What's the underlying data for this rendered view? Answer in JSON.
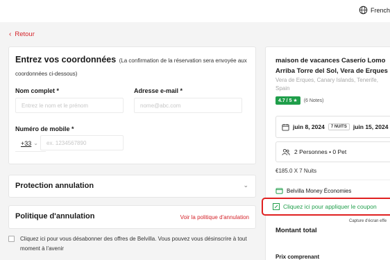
{
  "header": {
    "language": "French",
    "back_label": "Retour"
  },
  "contact": {
    "title": "Entrez vos coordonnées",
    "subtitle": "(La confirmation de la réservation sera envoyée aux coordonnées ci-dessous)",
    "full_name_label": "Nom complet *",
    "full_name_placeholder": "Entrez le nom et le prénom",
    "email_label": "Adresse e-mail *",
    "email_placeholder": "nome@abc.com",
    "mobile_label": "Numéro de mobile *",
    "country_code": "+33",
    "mobile_placeholder": "ex. 1234567890"
  },
  "protection": {
    "title": "Protection annulation"
  },
  "policy": {
    "title": "Politique d'annulation",
    "link_label": "Voir la politique d'annulation"
  },
  "unsubscribe": {
    "text": "Cliquez ici pour vous désabonner des offres de Belvilla. Vous pouvez vous désinscrire à tout moment à l'avenir"
  },
  "summary": {
    "property_title": "maison de vacances Caserío Lomo Arriba Torre del Sol, Vera de Erques",
    "location": "Vera de Erques, Canary Islands, Tenerife, Spain",
    "rating_badge": "4.7 / 5 ★",
    "rating_notes": "(6 Notes)",
    "check_in": "juin 8, 2024",
    "nights_badge": "7 NUITS",
    "check_out": "juin 15, 2024",
    "guests": "2 Personnes • 0 Pet",
    "price_line": "€185.0 X 7 Nuits",
    "economies_label": "Belvilla Money Économies",
    "coupon_label": "Cliquez ici pour appliquer le coupon",
    "capture_note": "Capture d'écran effe",
    "total_label": "Montant total",
    "includes_label": "Prix comprenant"
  },
  "colors": {
    "accent_red": "#d4232a",
    "success_green": "#1f9e4a",
    "highlight_red": "#e02020"
  },
  "icons": [
    "globe-icon",
    "chevron-left-icon",
    "chevron-down-icon",
    "calendar-icon",
    "people-icon",
    "wallet-icon",
    "coupon-icon"
  ]
}
